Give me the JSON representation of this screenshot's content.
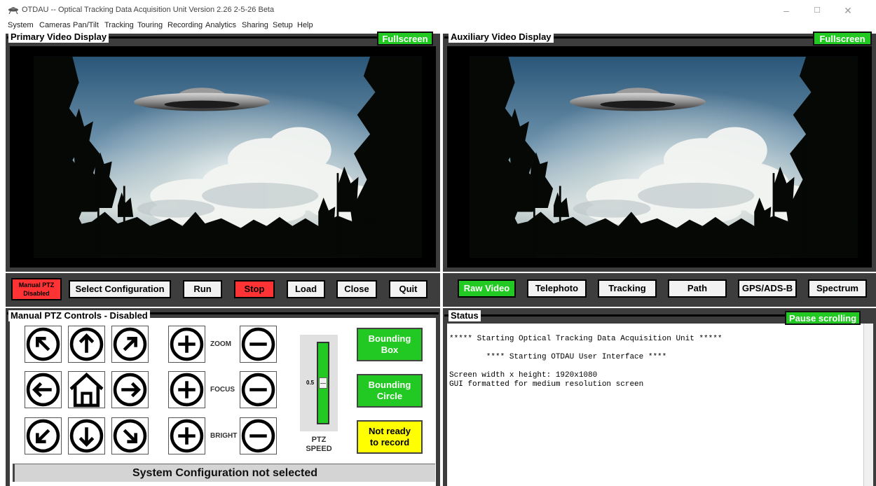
{
  "window": {
    "title": "OTDAU -- Optical Tracking Data Acquisition Unit   Version 2.26 2-5-26 Beta",
    "minimize_icon": "minimize-icon",
    "maximize_icon": "maximize-icon",
    "close_icon": "close-icon"
  },
  "menu": [
    "System",
    "Cameras",
    "Pan/Tilt",
    "Tracking",
    "Touring",
    "Recording",
    "Analytics",
    "Sharing",
    "Setup",
    "Help"
  ],
  "primary": {
    "label": "Primary Video Display",
    "fullscreen": "Fullscreen"
  },
  "auxiliary": {
    "label": "Auxiliary Video Display",
    "fullscreen": "Fullscreen"
  },
  "toolbar_left": {
    "manual_ptz_line1": "Manual PTZ",
    "manual_ptz_line2": "Disabled",
    "select_config": "Select Configuration",
    "run": "Run",
    "stop": "Stop",
    "load": "Load",
    "close": "Close",
    "quit": "Quit"
  },
  "toolbar_right": {
    "raw_video": "Raw Video",
    "telephoto": "Telephoto",
    "tracking": "Tracking",
    "path": "Path",
    "gps": "GPS/ADS-B",
    "spectrum": "Spectrum"
  },
  "ptz": {
    "label": "Manual PTZ Controls - Disabled",
    "zoom": "ZOOM",
    "focus": "FOCUS",
    "bright": "BRIGHT",
    "speed_value": "0.5",
    "speed_fraction": 0.5,
    "speed_line1": "PTZ",
    "speed_line2": "SPEED",
    "bbox_line1": "Bounding",
    "bbox_line2": "Box",
    "bcircle_line1": "Bounding",
    "bcircle_line2": "Circle",
    "record_line1": "Not ready",
    "record_line2": "to record",
    "status_bar": "System Configuration not selected",
    "icons": [
      "arrow-up-left-icon",
      "arrow-up-icon",
      "arrow-up-right-icon",
      "arrow-left-icon",
      "home-icon",
      "arrow-right-icon",
      "arrow-down-left-icon",
      "arrow-down-icon",
      "arrow-down-right-icon",
      "plus-icon",
      "minus-icon"
    ]
  },
  "status": {
    "label": "Status",
    "pause": "Pause scrolling",
    "lines": [
      "***** Starting Optical Tracking Data Acquisition Unit *****",
      "",
      "        **** Starting OTDAU User Interface ****",
      "",
      "Screen width x height: 1920x1080",
      "GUI formatted for medium resolution screen"
    ]
  },
  "colors": {
    "panel_bg": "#3d3d3d",
    "accent_green": "#22c922",
    "stop_red": "#ff3333",
    "record_yellow": "#ffff00",
    "status_bar_gray": "#d4d4d4"
  }
}
